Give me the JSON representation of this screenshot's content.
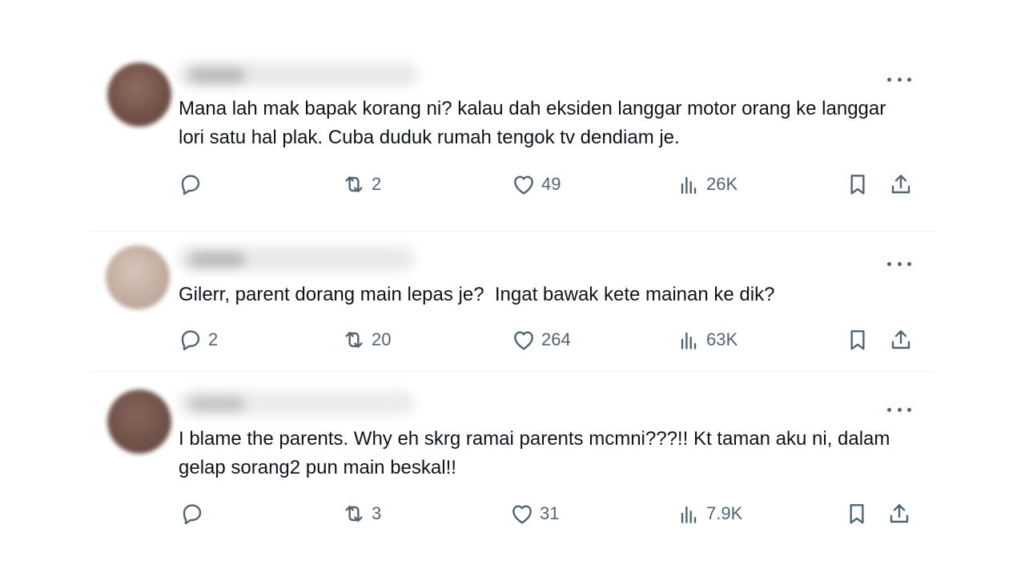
{
  "tweets": [
    {
      "text": "Mana lah mak bapak korang ni? kalau dah eksiden langgar motor orang ke langgar lori satu hal plak. Cuba duduk rumah tengok tv dendiam je.",
      "replies": "",
      "retweets": "2",
      "likes": "49",
      "views": "26K",
      "avatar_color": "#7a5a4e"
    },
    {
      "text": "Gilerr, parent dorang main lepas je?  Ingat bawak kete mainan ke dik?",
      "replies": "2",
      "retweets": "20",
      "likes": "264",
      "views": "63K",
      "avatar_color": "#c2ab9f"
    },
    {
      "text": "I blame the parents. Why eh skrg ramai parents mcmni???!! Kt taman aku ni, dalam gelap sorang2 pun main beskal!!",
      "replies": "",
      "retweets": "3",
      "likes": "31",
      "views": "7.9K",
      "avatar_color": "#6e5048"
    }
  ],
  "colors": {
    "icon": "#536471",
    "text": "#0f1419",
    "divider": "#eff3f4"
  },
  "icons": [
    "reply-icon",
    "retweet-icon",
    "like-icon",
    "views-icon",
    "bookmark-icon",
    "share-icon",
    "more-icon"
  ]
}
